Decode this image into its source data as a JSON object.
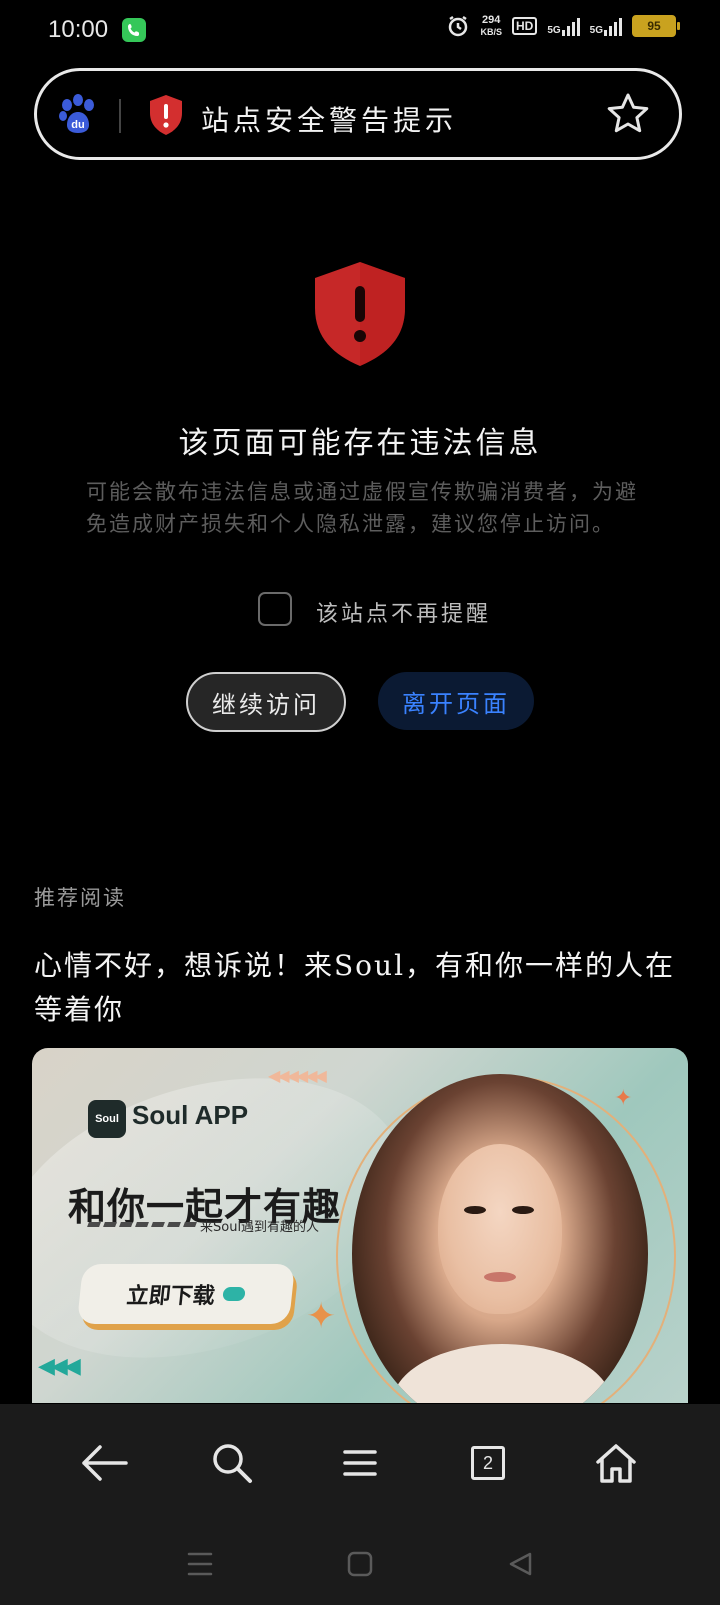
{
  "status_bar": {
    "time": "10:00",
    "net_speed_value": "294",
    "net_speed_unit": "KB/S",
    "hd_label": "HD",
    "signal1_label": "5G",
    "signal2_label": "5G",
    "battery": "95"
  },
  "address_bar": {
    "title": "站点安全警告提示",
    "icons": [
      "baidu-paw-icon",
      "warning-shield-icon",
      "star-icon"
    ]
  },
  "warning": {
    "title": "该页面可能存在违法信息",
    "body": "可能会散布违法信息或通过虚假宣传欺骗消费者，为避免造成财产损失和个人隐私泄露，建议您停止访问。",
    "checkbox_label": "该站点不再提醒",
    "continue_label": "继续访问",
    "leave_label": "离开页面",
    "accent_color": "#3a82ff",
    "shield_color": "#c62828"
  },
  "recommended": {
    "section_label": "推荐阅读",
    "article_title": "心情不好，想诉说！来Soul，有和你一样的人在等着你",
    "ad": {
      "logo_text": "Soul",
      "brand": "Soul APP",
      "headline": "和你一起才有趣",
      "subline": "来Soul遇到有趣的人",
      "cta": "立即下载"
    }
  },
  "toolbar": {
    "items": [
      "back-icon",
      "search-icon",
      "menu-icon",
      "tabs-icon",
      "home-icon"
    ],
    "tabs_count": "2"
  },
  "navbar": {
    "items": [
      "recents-icon",
      "home-square-icon",
      "back-triangle-icon"
    ]
  }
}
